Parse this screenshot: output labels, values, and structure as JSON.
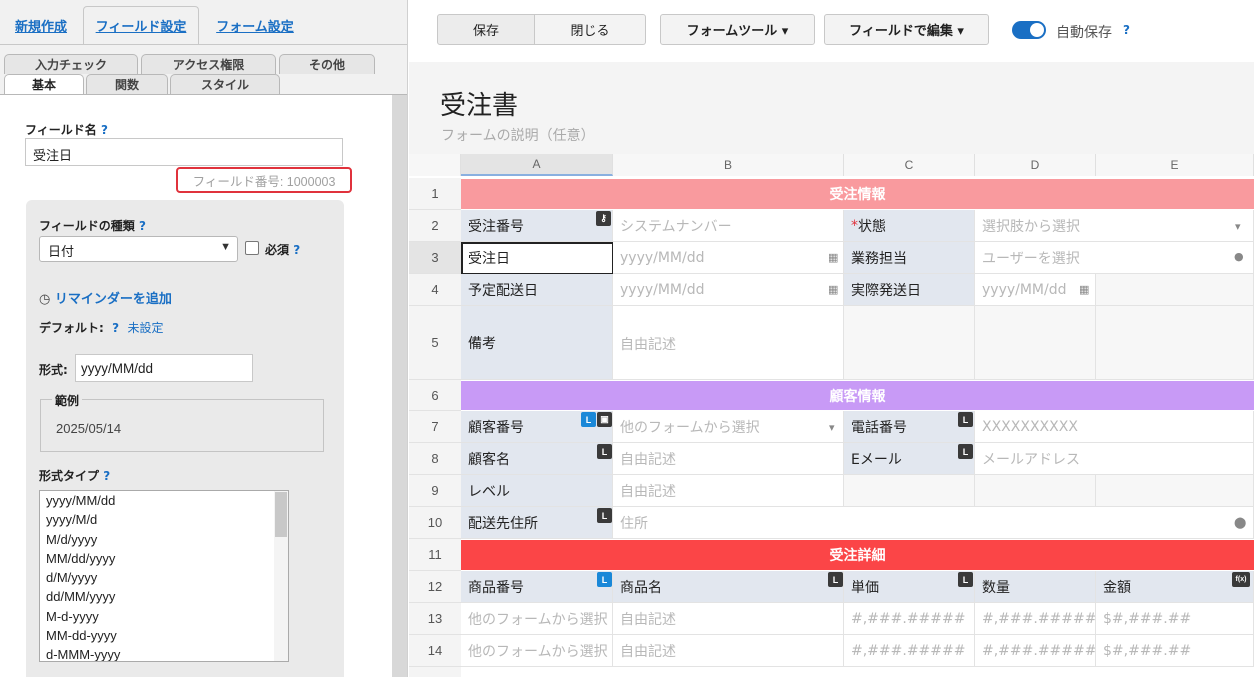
{
  "top_tabs": {
    "new": "新規作成",
    "field_settings": "フィールド設定",
    "form_settings": "フォーム設定"
  },
  "sub_tabs_row1": [
    "入力チェック",
    "アクセス権限",
    "その他"
  ],
  "sub_tabs_row2": [
    "基本",
    "関数",
    "スタイル"
  ],
  "field_name": {
    "label": "フィールド名",
    "help": "?",
    "value": "受注日",
    "field_number": "フィールド番号: 1000003"
  },
  "field_type": {
    "label": "フィールドの種類",
    "help": "?",
    "selected": "日付",
    "required_label": "必須",
    "required_checked": false,
    "required_help": "?"
  },
  "reminder": {
    "label": "リマインダーを追加"
  },
  "default": {
    "label": "デフォルト:",
    "help": "?",
    "value": "未設定"
  },
  "format": {
    "label": "形式:",
    "value": "yyyy/MM/dd"
  },
  "example": {
    "legend": "範例",
    "value": "2025/05/14"
  },
  "format_type": {
    "label": "形式タイプ",
    "help": "?",
    "options": [
      "yyyy/MM/dd",
      "yyyy/M/d",
      "M/d/yyyy",
      "MM/dd/yyyy",
      "d/M/yyyy",
      "dd/MM/yyyy",
      "M-d-yyyy",
      "MM-dd-yyyy",
      "d-MMM-yyyy"
    ]
  },
  "toolbar": {
    "save": "保存",
    "close": "閉じる",
    "form_tools": "フォームツール ▾",
    "edit_by_field": "フィールドで編集 ▾",
    "autosave": "自動保存",
    "autosave_help": "?",
    "autosave_on": true
  },
  "form": {
    "title": "受注書",
    "description": "フォームの説明（任意）"
  },
  "grid": {
    "columns": [
      "A",
      "B",
      "C",
      "D",
      "E"
    ],
    "rows": [
      "1",
      "2",
      "3",
      "4",
      "5",
      "6",
      "7",
      "8",
      "9",
      "10",
      "11",
      "12",
      "13",
      "14"
    ],
    "sections": {
      "order_info": "受注情報",
      "customer_info": "顧客情報",
      "order_detail": "受注詳細"
    },
    "colors": {
      "order_info": "#f99a9e",
      "customer_info": "#c89af6",
      "order_detail": "#fb4547"
    },
    "labels": {
      "order_number": "受注番号",
      "status_mark": "*",
      "status": "状態",
      "order_date": "受注日",
      "assignee": "業務担当",
      "planned_ship": "予定配送日",
      "actual_ship": "実際発送日",
      "notes": "備考",
      "customer_number": "顧客番号",
      "phone": "電話番号",
      "customer_name": "顧客名",
      "email": "Eメール",
      "level": "レベル",
      "ship_address": "配送先住所",
      "product_number": "商品番号",
      "product_name": "商品名",
      "unit_price": "単価",
      "quantity": "数量",
      "amount": "金額"
    },
    "placeholders": {
      "system_number": "システムナンバー",
      "choose_option": "選択肢から選択",
      "date": "yyyy/MM/dd",
      "choose_user": "ユーザーを選択",
      "free_text": "自由記述",
      "other_form": "他のフォームから選択",
      "phone": "XXXXXXXXXX",
      "email": "メールアドレス",
      "address": "住所",
      "number": "#,###.#####",
      "currency": "$#,###.##"
    },
    "badges": {
      "lookup": "L",
      "function": "f(x)"
    }
  }
}
